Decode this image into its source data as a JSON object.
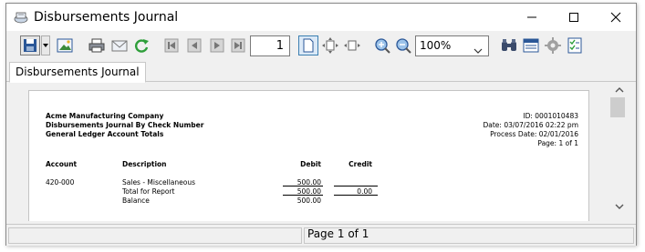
{
  "window": {
    "title": "Disbursements Journal"
  },
  "toolbar": {
    "page_number": "1",
    "zoom_value": "100%"
  },
  "tabs": [
    {
      "label": "Disbursements Journal"
    }
  ],
  "report": {
    "company": "Acme Manufacturing Company",
    "subtitle": "Disbursements Journal By Check Number",
    "subtitle2": "General Ledger Account Totals",
    "id_line": "ID: 0001010483",
    "date_line": "Date: 03/07/2016 02:22 pm",
    "process_date_line": "Process Date: 02/01/2016",
    "page_line": "Page: 1 of 1",
    "columns": {
      "account": "Account",
      "description": "Description",
      "debit": "Debit",
      "credit": "Credit"
    },
    "row": {
      "account": "420-000",
      "description": "Sales - Miscellaneous",
      "debit": "500.00"
    },
    "total": {
      "label": "Total for Report",
      "debit": "500.00",
      "credit": "0.00"
    },
    "balance": {
      "label": "Balance",
      "debit": "500.00"
    }
  },
  "status": {
    "page_text": "Page 1 of 1"
  },
  "colors": {
    "accent": "#3c7fb1",
    "toolbar_bg": "#f0f0f0",
    "refresh_green": "#2e9e3a"
  }
}
